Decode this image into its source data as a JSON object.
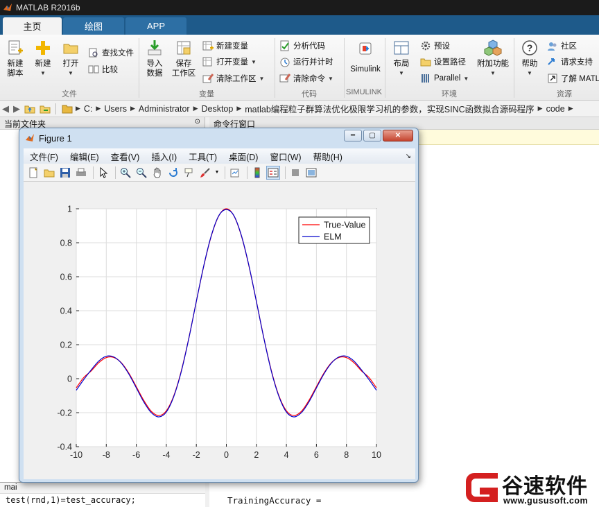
{
  "app": {
    "title": "MATLAB R2016b"
  },
  "tabs": [
    {
      "label": "主页",
      "active": true
    },
    {
      "label": "绘图",
      "active": false
    },
    {
      "label": "APP",
      "active": false
    }
  ],
  "ribbon": {
    "file": {
      "new_script": "新建\n脚本",
      "new": "新建",
      "open": "打开",
      "find_files": "查找文件",
      "compare": "比较",
      "group": "文件"
    },
    "variable": {
      "import": "导入\n数据",
      "save_ws": "保存\n工作区",
      "new_var": "新建变量",
      "open_var": "打开变量",
      "clear_ws": "清除工作区",
      "group": "变量"
    },
    "code": {
      "analyze": "分析代码",
      "run_time": "运行并计时",
      "clear_cmd": "清除命令",
      "group": "代码"
    },
    "simulink": {
      "label": "Simulink",
      "group": "SIMULINK"
    },
    "environment": {
      "layout": "布局",
      "prefs": "预设",
      "set_path": "设置路径",
      "parallel": "Parallel",
      "addons": "附加功能",
      "group": "环境"
    },
    "resources": {
      "help": "帮助",
      "community": "社区",
      "support": "请求支持",
      "learn": "了解 MATL",
      "group": "资源"
    }
  },
  "address": {
    "crumbs": [
      "C:",
      "Users",
      "Administrator",
      "Desktop",
      "matlab编程粒子群算法优化极限学习机的参数，实现SINC函数拟合源码程序",
      "code"
    ]
  },
  "panels": {
    "current_folder": "当前文件夹",
    "command_window": "命令行窗口",
    "detail_label": "mai",
    "left_code": "test(rnd,1)=test_accuracy;",
    "cmd_output": "TrainingAccuracy ="
  },
  "figure": {
    "title": "Figure 1",
    "menu": [
      "文件(F)",
      "编辑(E)",
      "查看(V)",
      "插入(I)",
      "工具(T)",
      "桌面(D)",
      "窗口(W)",
      "帮助(H)"
    ],
    "toolbar_icons": [
      "new-figure-icon",
      "open-icon",
      "save-icon",
      "print-icon",
      "pointer-icon",
      "zoom-in-icon",
      "zoom-out-icon",
      "pan-icon",
      "rotate-icon",
      "data-cursor-icon",
      "brush-icon",
      "link-icon",
      "colorbar-icon",
      "legend-icon",
      "hide-plot-tools-icon",
      "show-plot-tools-icon"
    ]
  },
  "chart_data": {
    "type": "line",
    "title": "",
    "xlabel": "",
    "ylabel": "",
    "xlim": [
      -10,
      10
    ],
    "ylim": [
      -0.4,
      1
    ],
    "xticks": [
      -10,
      -8,
      -6,
      -4,
      -2,
      0,
      2,
      4,
      6,
      8,
      10
    ],
    "yticks": [
      -0.4,
      -0.2,
      0,
      0.2,
      0.4,
      0.6,
      0.8,
      1
    ],
    "grid": true,
    "legend": "top-right",
    "series": [
      {
        "name": "True-Value",
        "color": "#ff0000",
        "x": [
          -10,
          -9.5,
          -9,
          -8.5,
          -8,
          -7.5,
          -7,
          -6.5,
          -6,
          -5.5,
          -5,
          -4.5,
          -4,
          -3.5,
          -3,
          -2.5,
          -2,
          -1.5,
          -1,
          -0.5,
          0,
          0.5,
          1,
          1.5,
          2,
          2.5,
          3,
          3.5,
          4,
          4.5,
          5,
          5.5,
          6,
          6.5,
          7,
          7.5,
          8,
          8.5,
          9,
          9.5,
          10
        ],
        "y": [
          -0.054,
          0.007,
          0.046,
          0.094,
          0.124,
          0.125,
          0.094,
          0.033,
          -0.047,
          -0.128,
          -0.192,
          -0.217,
          -0.189,
          -0.1,
          0.047,
          0.239,
          0.455,
          0.665,
          0.841,
          0.959,
          1.0,
          0.959,
          0.841,
          0.665,
          0.455,
          0.239,
          0.047,
          -0.1,
          -0.189,
          -0.217,
          -0.192,
          -0.128,
          -0.047,
          0.033,
          0.094,
          0.125,
          0.124,
          0.094,
          0.046,
          0.007,
          -0.054
        ]
      },
      {
        "name": "ELM",
        "color": "#0000cc",
        "x": [
          -10,
          -9.5,
          -9,
          -8.5,
          -8,
          -7.5,
          -7,
          -6.5,
          -6,
          -5.5,
          -5,
          -4.5,
          -4,
          -3.5,
          -3,
          -2.5,
          -2,
          -1.5,
          -1,
          -0.5,
          0,
          0.5,
          1,
          1.5,
          2,
          2.5,
          3,
          3.5,
          4,
          4.5,
          5,
          5.5,
          6,
          6.5,
          7,
          7.5,
          8,
          8.5,
          9,
          9.5,
          10
        ],
        "y": [
          -0.068,
          -0.005,
          0.052,
          0.104,
          0.132,
          0.128,
          0.092,
          0.028,
          -0.054,
          -0.137,
          -0.2,
          -0.225,
          -0.196,
          -0.104,
          0.043,
          0.237,
          0.455,
          0.667,
          0.843,
          0.96,
          0.995,
          0.96,
          0.843,
          0.667,
          0.455,
          0.237,
          0.043,
          -0.104,
          -0.196,
          -0.225,
          -0.2,
          -0.137,
          -0.054,
          0.028,
          0.092,
          0.128,
          0.132,
          0.104,
          0.052,
          -0.005,
          -0.068
        ]
      }
    ]
  },
  "watermark": {
    "brand": "谷速软件",
    "url": "www.gususoft.com",
    "color": "#d42020"
  }
}
